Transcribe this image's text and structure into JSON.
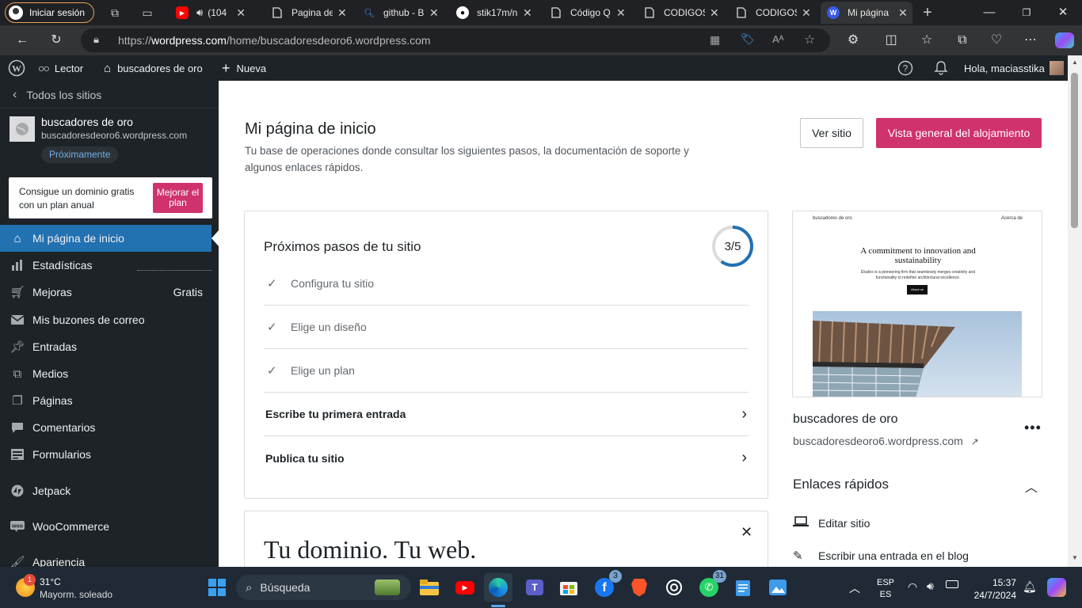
{
  "browser": {
    "profile_label": "Iniciar sesión",
    "tabs": [
      {
        "title": "(104",
        "icon": "youtube-icon"
      },
      {
        "title": "Pagina de",
        "icon": "document-icon"
      },
      {
        "title": "github - B",
        "icon": "search-icon"
      },
      {
        "title": "stik17m/n",
        "icon": "github-icon"
      },
      {
        "title": "Código Q",
        "icon": "document-icon"
      },
      {
        "title": "CODIGOS",
        "icon": "document-icon"
      },
      {
        "title": "CODIGOS",
        "icon": "document-icon"
      },
      {
        "title": "Mi página",
        "icon": "wordpress-icon",
        "active": true
      }
    ],
    "url_prefix": "https://",
    "url_domain": "wordpress.com",
    "url_path": "/home/buscadoresdeoro6.wordpress.com"
  },
  "admin_bar": {
    "reader": "Lector",
    "site": "buscadores de oro",
    "new": "Nueva",
    "greeting": "Hola, maciasstika"
  },
  "sidebar": {
    "back": "Todos los sitios",
    "site_name": "buscadores de oro",
    "site_url": "buscadoresdeoro6.wordpress.com",
    "status_badge": "Próximamente",
    "promo_text": "Consigue un dominio gratis con un plan anual",
    "promo_button": "Mejorar el plan",
    "menu": [
      {
        "label": "Mi página de inicio",
        "icon": "home-icon",
        "active": true
      },
      {
        "label": "Estadísticas",
        "icon": "stats-icon"
      },
      {
        "label": "Mejoras",
        "icon": "cart-icon",
        "extra": "Gratis"
      },
      {
        "label": "Mis buzones de correo",
        "icon": "mail-icon"
      },
      {
        "label": "Entradas",
        "icon": "pin-icon"
      },
      {
        "label": "Medios",
        "icon": "media-icon"
      },
      {
        "label": "Páginas",
        "icon": "pages-icon"
      },
      {
        "label": "Comentarios",
        "icon": "comment-icon"
      },
      {
        "label": "Formularios",
        "icon": "forms-icon"
      },
      {
        "label": "Jetpack",
        "icon": "jetpack-icon"
      },
      {
        "label": "WooCommerce",
        "icon": "woocommerce-icon"
      },
      {
        "label": "Apariencia",
        "icon": "brush-icon"
      }
    ]
  },
  "main": {
    "title": "Mi página de inicio",
    "subtitle": "Tu base de operaciones donde consultar los siguientes pasos, la documentación de soporte y algunos enlaces rápidos.",
    "view_site": "Ver sitio",
    "hosting_overview": "Vista general del alojamiento",
    "next_steps": {
      "title": "Próximos pasos de tu sitio",
      "progress_label": "3/5",
      "progress_fraction": 0.6,
      "steps": [
        {
          "label": "Configura tu sitio",
          "done": true
        },
        {
          "label": "Elige un diseño",
          "done": true
        },
        {
          "label": "Elige un plan",
          "done": true
        },
        {
          "label": "Escribe tu primera entrada",
          "done": false
        },
        {
          "label": "Publica tu sitio",
          "done": false
        }
      ]
    },
    "domain_card": {
      "title": "Tu dominio. Tu web."
    }
  },
  "preview": {
    "header_left": "buscadores de oro",
    "header_right": "Acerca de",
    "headline": "A commitment to innovation and sustainability",
    "body": "Études is a pioneering firm that seamlessly merges creativity and functionality to redefine architectural excellence.",
    "button": "About us"
  },
  "site_info": {
    "name": "buscadores de oro",
    "url": "buscadoresdeoro6.wordpress.com",
    "ext_icon": "↗"
  },
  "quick_links": {
    "title": "Enlaces rápidos",
    "items": [
      {
        "label": "Editar sitio",
        "icon": "laptop-icon"
      },
      {
        "label": "Escribir una entrada en el blog",
        "icon": "pencil-icon"
      }
    ]
  },
  "taskbar": {
    "weather_temp": "31°C",
    "weather_desc": "Mayorm. soleado",
    "weather_badge": "1",
    "search": "Búsqueda",
    "lang1": "ESP",
    "lang2": "ES",
    "time": "15:37",
    "date": "24/7/2024",
    "badges": {
      "facebook": "3",
      "whatsapp": "31"
    }
  },
  "colors": {
    "wp_dark": "#1d2327",
    "wp_active": "#2271b1",
    "accent_pink": "#d0326e",
    "progress": "#2271b1"
  }
}
